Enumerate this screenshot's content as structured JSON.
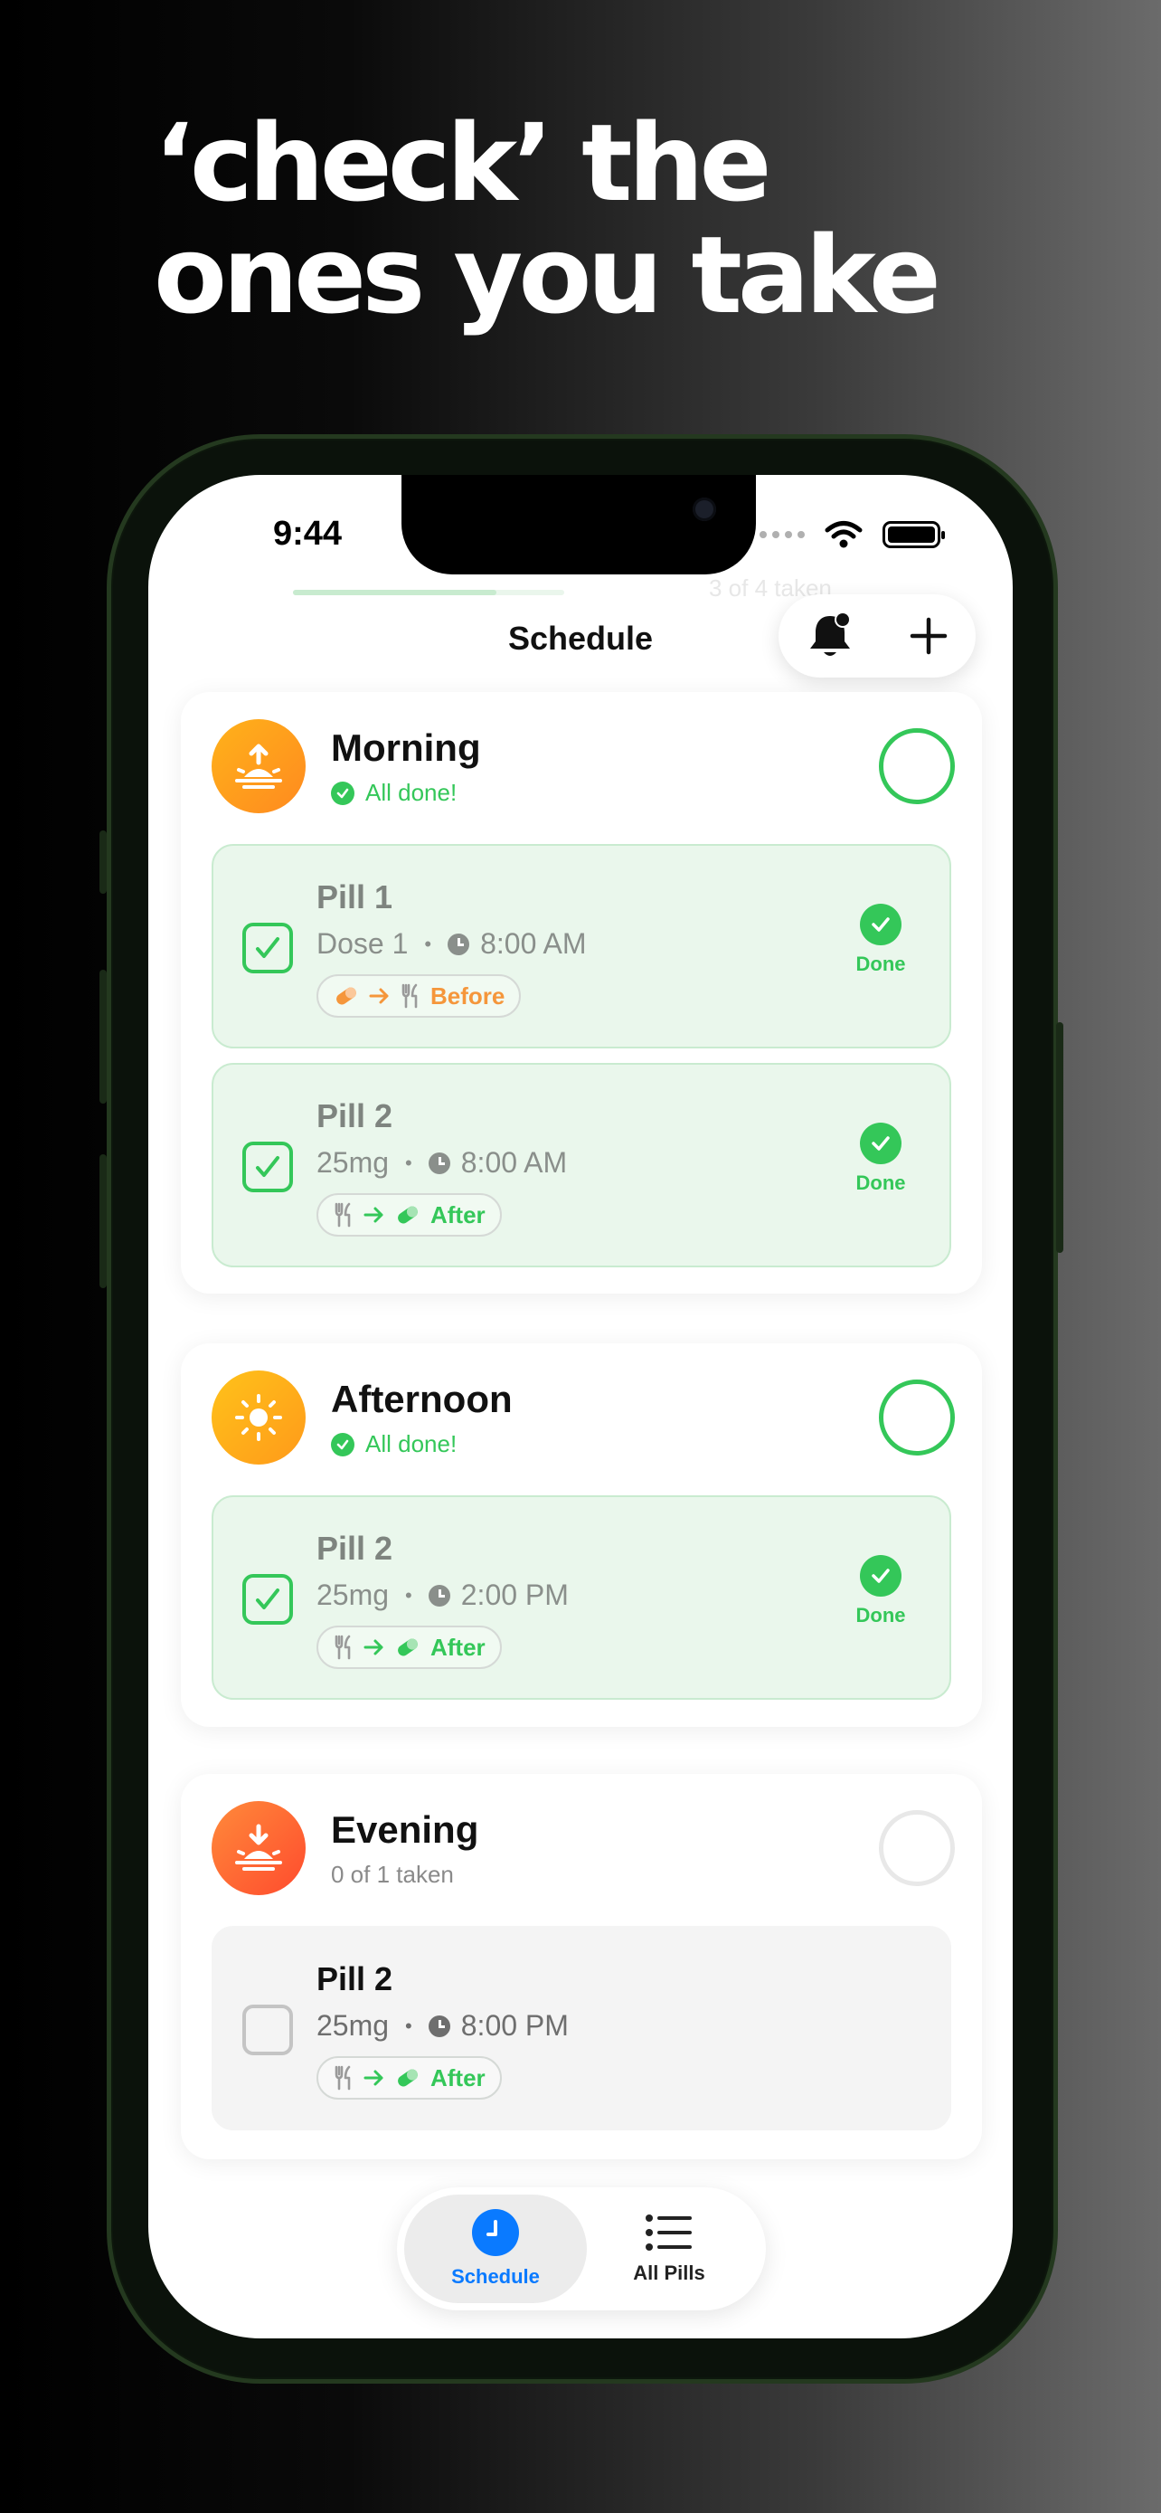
{
  "headline": {
    "line1": "‘check’ the",
    "line2": "ones you take"
  },
  "status_bar": {
    "time": "9:44"
  },
  "nav": {
    "title": "Schedule",
    "progress_text": "3 of 4 taken",
    "progress_fraction": 0.75,
    "bell_icon": "bell-badge-icon",
    "add_icon": "plus-icon"
  },
  "colors": {
    "accent_green": "#34c759",
    "tab_active_blue": "#0a7aff",
    "before_orange": "#f5963b",
    "morning_gradient": [
      "#ffb21a",
      "#ff8a1f"
    ],
    "afternoon_gradient": [
      "#ffc21a",
      "#ff9a1a"
    ],
    "evening_gradient": [
      "#ff8a3a",
      "#ff4b2e"
    ]
  },
  "groups": [
    {
      "title": "Morning",
      "subtitle": "All done!",
      "icon": "sunrise-icon",
      "pills": [
        {
          "name": "Pill 1",
          "dose": "Dose 1",
          "time": "8:00 AM",
          "timing": "Before",
          "status": "Done",
          "checked": true
        },
        {
          "name": "Pill 2",
          "dose": "25mg",
          "time": "8:00 AM",
          "timing": "After",
          "status": "Done",
          "checked": true
        }
      ]
    },
    {
      "title": "Afternoon",
      "subtitle": "All done!",
      "icon": "sun-icon",
      "pills": [
        {
          "name": "Pill 2",
          "dose": "25mg",
          "time": "2:00 PM",
          "timing": "After",
          "status": "Done",
          "checked": true
        }
      ]
    },
    {
      "title": "Evening",
      "subtitle": "0 of 1 taken",
      "icon": "sunset-icon",
      "pills": [
        {
          "name": "Pill 2",
          "dose": "25mg",
          "time": "8:00 PM",
          "timing": "After",
          "status": "",
          "checked": false
        }
      ]
    }
  ],
  "tabbar": {
    "tabs": [
      {
        "label": "Schedule",
        "icon": "clock-icon",
        "active": true
      },
      {
        "label": "All Pills",
        "icon": "list-icon",
        "active": false
      }
    ]
  }
}
